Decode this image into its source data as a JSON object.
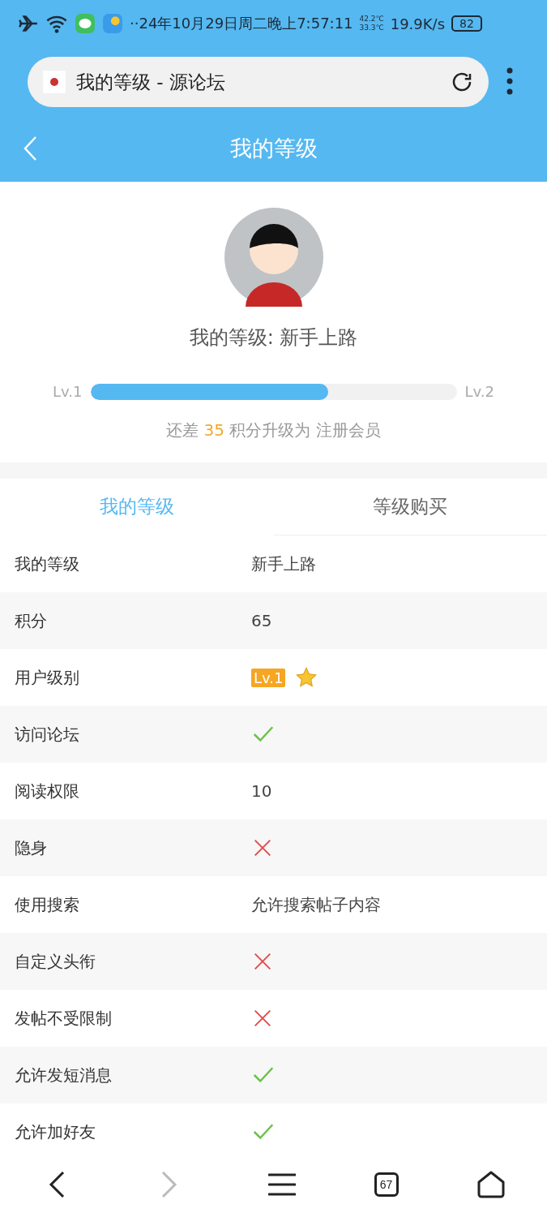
{
  "status_bar": {
    "time": "··24年10月29日周二晚上7:57:11",
    "temp_high": "42.2℃",
    "temp_low": "33.3℃",
    "speed": "19.9K/s",
    "battery": "82"
  },
  "address_bar": {
    "title": "我的等级 - 源论坛"
  },
  "header": {
    "title": "我的等级"
  },
  "profile": {
    "level_text": "我的等级: 新手上路",
    "from": "Lv.1",
    "to": "Lv.2",
    "level": 0.65,
    "hint_prefix": "还差",
    "points": "35",
    "hint_suffix": "积分升级为 注册会员"
  },
  "tabs": [
    {
      "label": "我的等级",
      "selected": true
    },
    {
      "label": "等级购买",
      "selected": false
    }
  ],
  "rows": [
    {
      "label": "我的等级",
      "kind": "text",
      "value": "新手上路"
    },
    {
      "label": "积分",
      "kind": "text",
      "value": "65"
    },
    {
      "label": "用户级别",
      "kind": "badge",
      "value": "Lv.1"
    },
    {
      "label": "访问论坛",
      "kind": "check"
    },
    {
      "label": "阅读权限",
      "kind": "text",
      "value": "10"
    },
    {
      "label": "隐身",
      "kind": "cross"
    },
    {
      "label": "使用搜索",
      "kind": "text",
      "value": "允许搜索帖子内容"
    },
    {
      "label": "自定义头衔",
      "kind": "cross"
    },
    {
      "label": "发帖不受限制",
      "kind": "cross"
    },
    {
      "label": "允许发短消息",
      "kind": "check"
    },
    {
      "label": "允许加好友",
      "kind": "check"
    }
  ],
  "bottom_nav": {
    "tabs_count": "67"
  }
}
